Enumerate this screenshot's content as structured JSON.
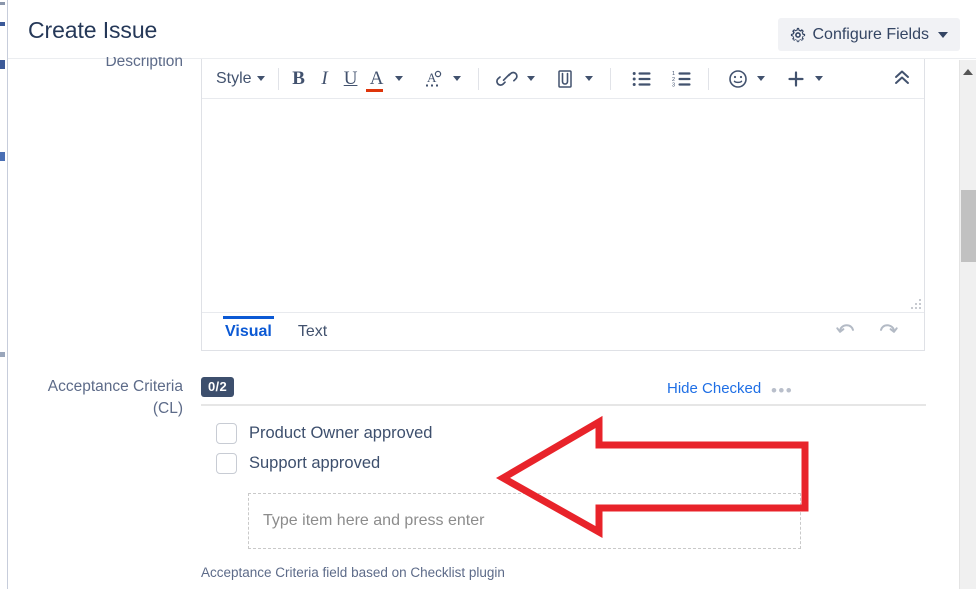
{
  "header": {
    "title": "Create Issue",
    "configure_button": {
      "label": "Configure Fields",
      "icon": "gear-icon",
      "caret": "chevron-down-icon"
    }
  },
  "fields": {
    "description": {
      "label": "Description",
      "editor": {
        "toolbar": {
          "style_label": "Style",
          "bold": "B",
          "italic": "I",
          "underline": "U",
          "text_color": "A",
          "text_color_accent": "#de350b",
          "highlight": "A",
          "link_icon": "link-icon",
          "attachment_icon": "paperclip-icon",
          "bullet_list_icon": "bulleted-list-icon",
          "numbered_list_icon": "numbered-list-icon",
          "emoji_icon": "emoji-icon",
          "insert_icon": "plus-icon",
          "collapse_icon": "chevron-double-up-icon"
        },
        "content": "",
        "tabs": [
          {
            "label": "Visual",
            "active": true
          },
          {
            "label": "Text",
            "active": false
          }
        ],
        "undo_icon": "undo-icon",
        "redo_icon": "redo-icon",
        "resize_handle": "resize-grip-icon"
      }
    },
    "acceptance_criteria": {
      "label_line1": "Acceptance Criteria",
      "label_line2": "(CL)",
      "progress_badge": "0/2",
      "hide_checked_label": "Hide Checked",
      "more_options": "•••",
      "items": [
        {
          "text": "Product Owner approved",
          "checked": false
        },
        {
          "text": "Support approved",
          "checked": false
        }
      ],
      "new_item_placeholder": "Type item here and press enter",
      "new_item_value": "",
      "footnote": "Acceptance Criteria field based on Checklist plugin"
    }
  },
  "annotation": {
    "shape": "left-pointing-arrow",
    "color": "#e8232a"
  },
  "scrollbar": {
    "up_arrow": "scroll-up-arrow-icon",
    "thumb": "scrollbar-thumb"
  },
  "colors": {
    "accent_blue": "#0b59d4",
    "link_blue": "#1f6fe5",
    "badge_navy": "#3d4f6d",
    "text_navy": "#253858",
    "annotation_red": "#e8232a"
  }
}
